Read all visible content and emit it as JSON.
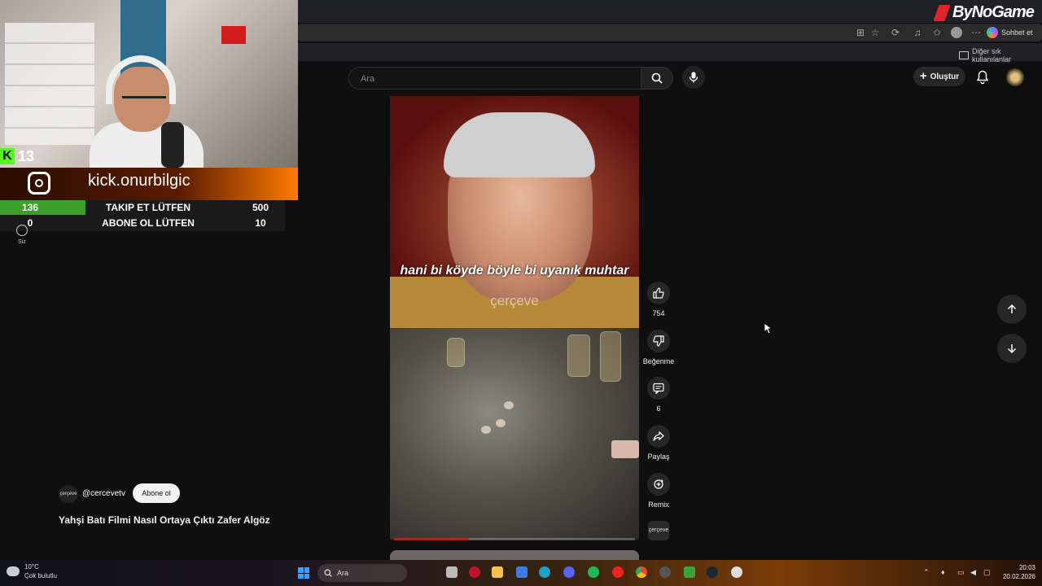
{
  "brand": {
    "overlay_logo": "ByNoGame"
  },
  "browser": {
    "chat_button": "Sohbet et",
    "bookmarks_folder": "Diğer sık kullanılanlar"
  },
  "header": {
    "search_placeholder": "Ara",
    "create_label": "Oluştur"
  },
  "stream_overlay": {
    "kick_viewers": "13",
    "instagram_handle": "kick.onurbilgic",
    "goals": [
      {
        "current": "136",
        "label": "TAKIP ET LÜTFEN",
        "target": "500"
      },
      {
        "current": "0",
        "label": "ABONE OL LÜTFEN",
        "target": "10"
      }
    ]
  },
  "sidebar": {
    "you_label": "Siz"
  },
  "short": {
    "subtitle": "hani bi köyde böyle bi uyanık muhtar",
    "watermark": "çerçeve",
    "progress": 0.31,
    "channel_handle": "@cercevetv",
    "channel_avatar_text": "çerçeve",
    "subscribe_label": "Abone ol",
    "title": "Yahşi Batı Filmi Nasıl Ortaya Çıktı Zafer Algöz"
  },
  "actions": {
    "like_count": "754",
    "dislike_label": "Beğenme",
    "comment_count": "6",
    "share_label": "Paylaş",
    "remix_label": "Remix",
    "channel_thumb_text": "çerçeve"
  },
  "taskbar": {
    "weather_temp": "10°C",
    "weather_desc": "Çok bulutlu",
    "search_label": "Ara",
    "time": "20:03",
    "date": "20.02.2026"
  },
  "colors": {
    "accent_red": "#ff0000",
    "kick_green": "#53fc18",
    "background": "#0f0f0f"
  },
  "icons": [
    "search-icon",
    "mic-icon",
    "plus-icon",
    "bell-icon",
    "like-icon",
    "dislike-icon",
    "comment-icon",
    "share-icon",
    "remix-icon",
    "arrow-up-icon",
    "arrow-down-icon",
    "instagram-icon",
    "person-icon",
    "windows-start-icon"
  ]
}
